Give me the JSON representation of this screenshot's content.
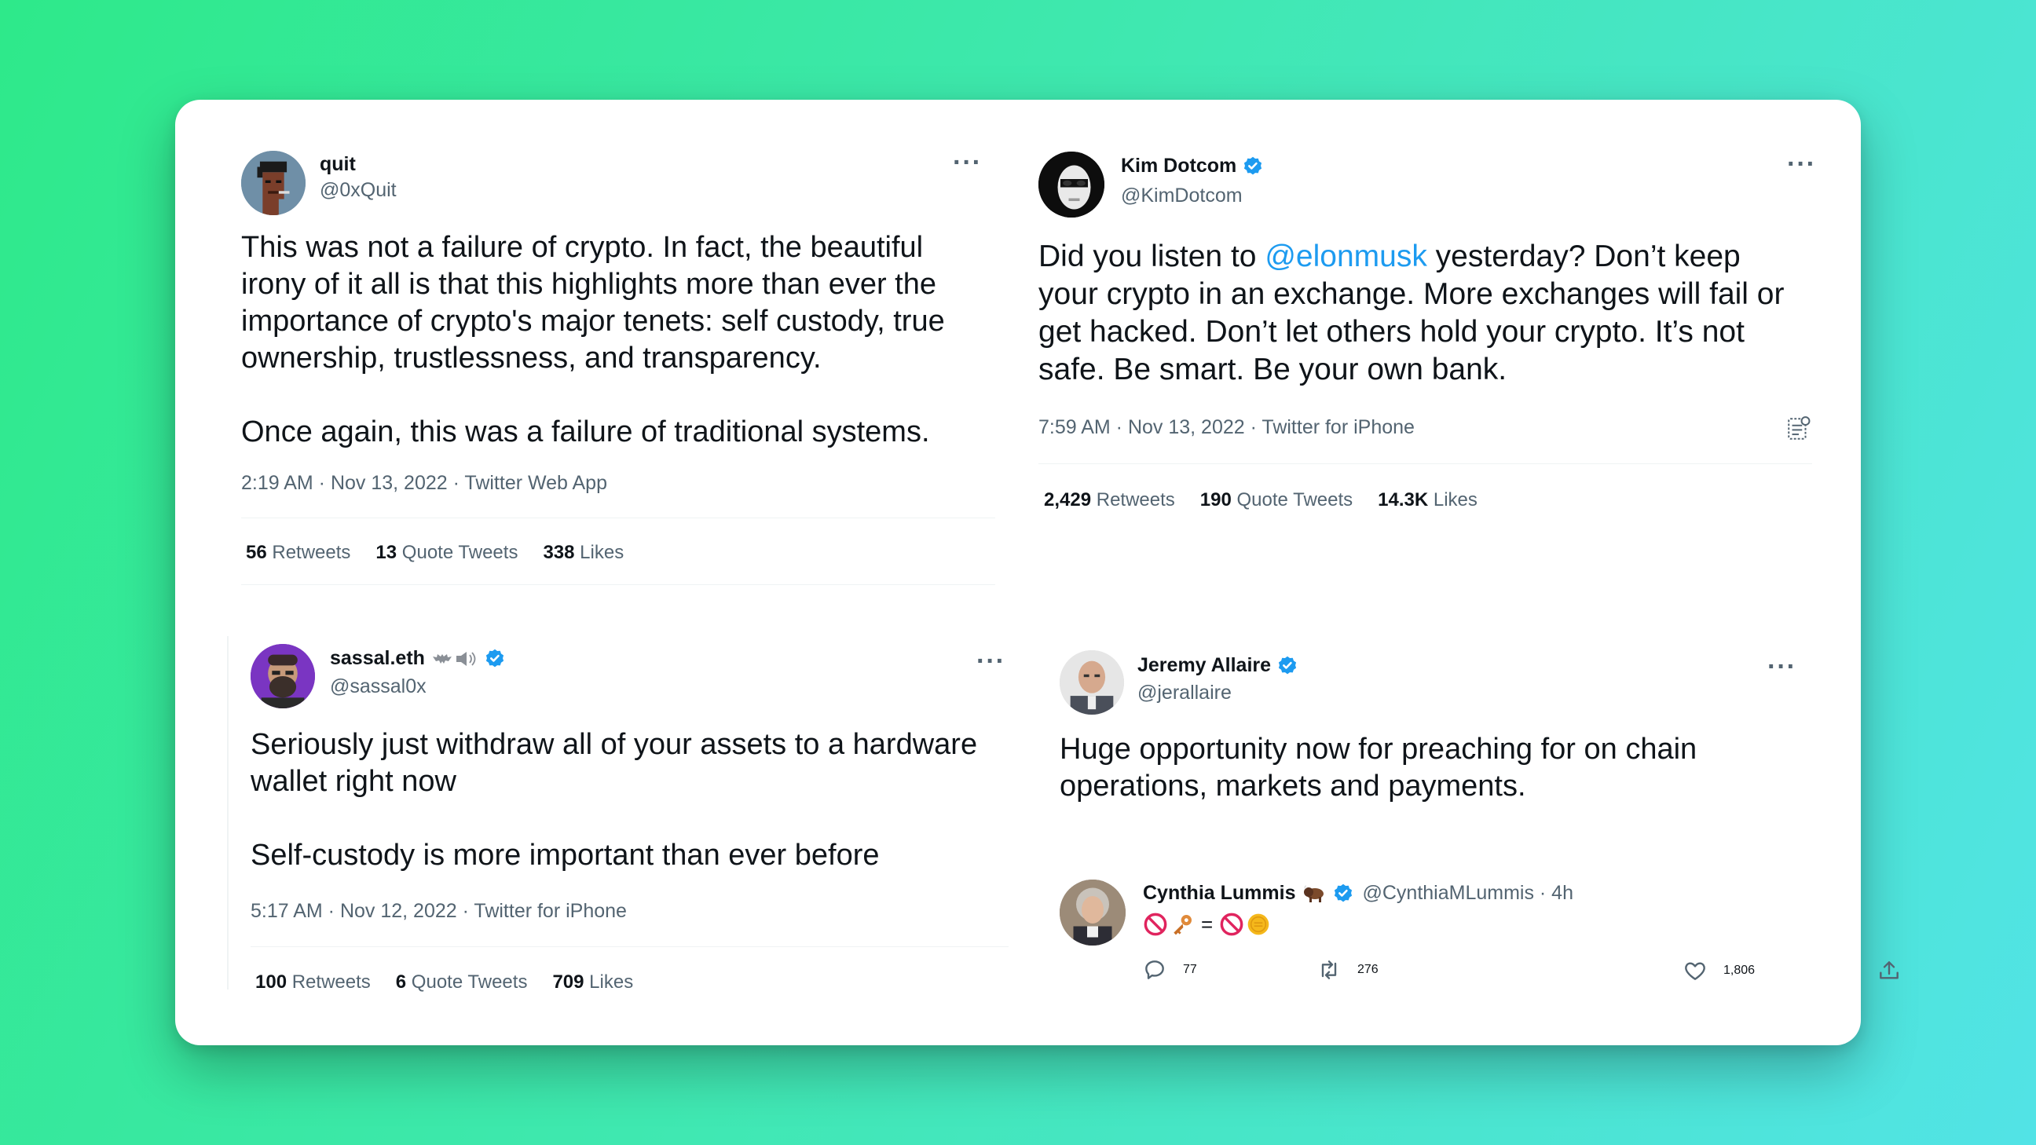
{
  "tweets": [
    {
      "name": "quit",
      "handle": "@0xQuit",
      "lines": [
        "This was not a failure of crypto. In fact, the beautiful",
        "irony of it all is that this highlights more than ever the",
        "importance of crypto's major tenets: self custody, true",
        "ownership, trustlessness, and transparency.",
        "",
        "Once again, this was a failure of traditional systems."
      ],
      "meta": "2:19 AM · Nov 13, 2022 · Twitter Web App",
      "retweets": "56",
      "retweets_label": "Retweets",
      "quotes": "13",
      "quotes_label": "Quote Tweets",
      "likes": "338",
      "likes_label": "Likes"
    },
    {
      "name": "Kim Dotcom",
      "handle": "@KimDotcom",
      "line1_prefix": "Did you listen to ",
      "mention": "@elonmusk",
      "line1_suffix": " yesterday? Don’t keep",
      "lines": [
        "your crypto in an exchange. More exchanges will fail or",
        "get hacked. Don’t let others hold your crypto. It’s not",
        "safe. Be smart. Be your own bank."
      ],
      "meta": "7:59 AM · Nov 13, 2022 · Twitter for iPhone",
      "retweets": "2,429",
      "retweets_label": "Retweets",
      "quotes": "190",
      "quotes_label": "Quote Tweets",
      "likes": "14.3K",
      "likes_label": "Likes"
    },
    {
      "name": "sassal.eth",
      "handle": "@sassal0x",
      "lines": [
        "Seriously just withdraw all of your assets to a hardware",
        "wallet right now",
        "",
        "Self-custody is more important than ever before"
      ],
      "meta": "5:17 AM · Nov 12, 2022 · Twitter for iPhone",
      "retweets": "100",
      "retweets_label": "Retweets",
      "quotes": "6",
      "quotes_label": "Quote Tweets",
      "likes": "709",
      "likes_label": "Likes"
    },
    {
      "name": "Jeremy Allaire",
      "handle": "@jerallaire",
      "lines": [
        "Huge opportunity now for preaching for on chain",
        "operations, markets and payments."
      ],
      "reply": {
        "name": "Cynthia Lummis",
        "handle_time": "@CynthiaMLummis · 4h",
        "equals": "=",
        "replies": "77",
        "retweets": "276",
        "likes": "1,806"
      }
    }
  ],
  "colors": {
    "accent": "#1d9bf0",
    "verified": "#1d9bf0",
    "secondary_text": "#536471"
  },
  "icons": [
    "more-icon",
    "verified-badge-icon",
    "analytics-icon",
    "reply-icon",
    "retweet-icon",
    "like-icon",
    "share-icon"
  ]
}
